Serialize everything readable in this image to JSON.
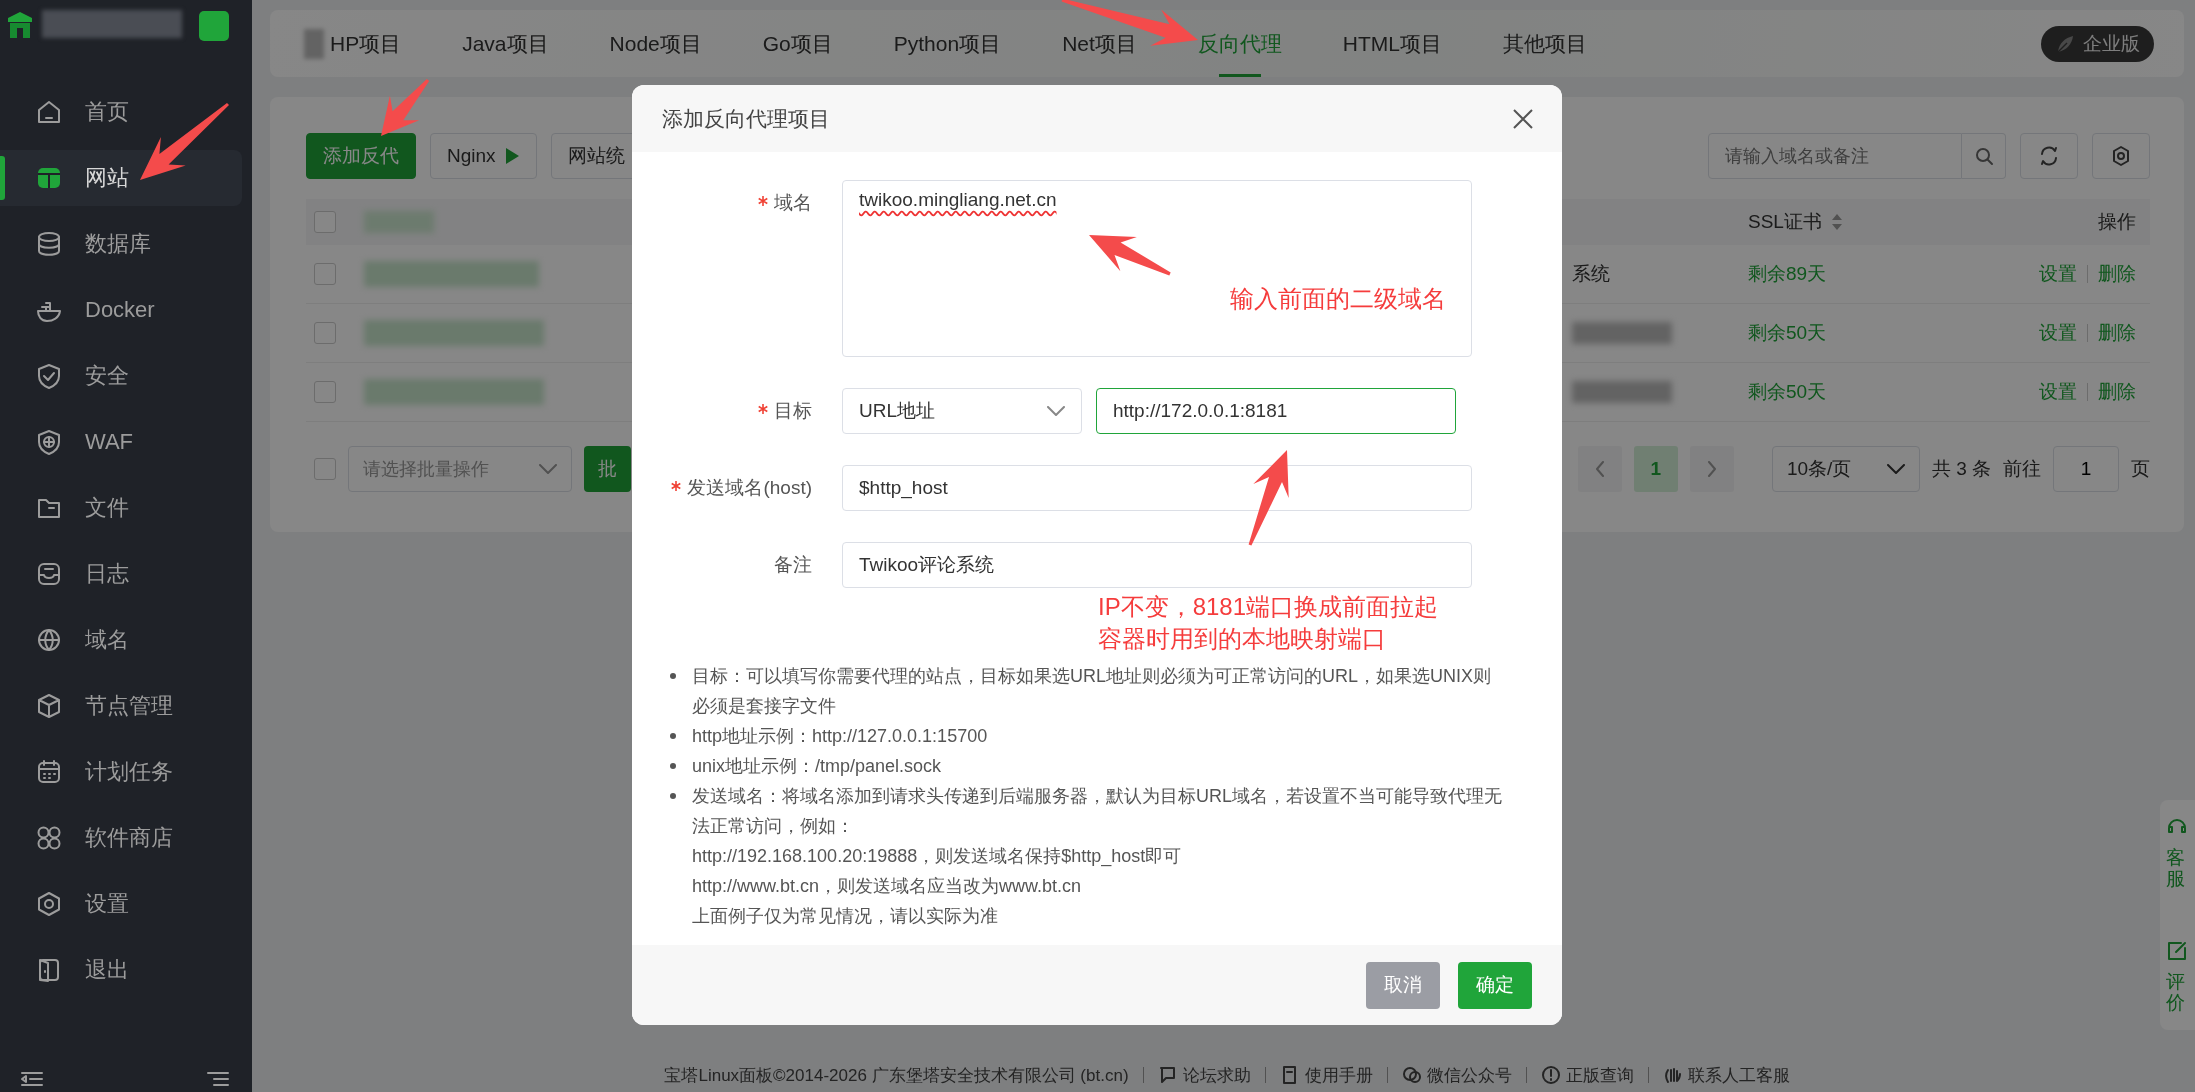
{
  "sidebar": {
    "items": [
      {
        "label": "首页",
        "selected": false
      },
      {
        "label": "网站",
        "selected": true
      },
      {
        "label": "数据库",
        "selected": false
      },
      {
        "label": "Docker",
        "selected": false
      },
      {
        "label": "安全",
        "selected": false
      },
      {
        "label": "WAF",
        "selected": false
      },
      {
        "label": "文件",
        "selected": false
      },
      {
        "label": "日志",
        "selected": false
      },
      {
        "label": "域名",
        "selected": false
      },
      {
        "label": "节点管理",
        "selected": false
      },
      {
        "label": "计划任务",
        "selected": false
      },
      {
        "label": "软件商店",
        "selected": false
      },
      {
        "label": "设置",
        "selected": false
      },
      {
        "label": "退出",
        "selected": false
      }
    ]
  },
  "tabs": [
    {
      "label": "HP项目",
      "selected": false
    },
    {
      "label": "Java项目",
      "selected": false
    },
    {
      "label": "Node项目",
      "selected": false
    },
    {
      "label": "Go项目",
      "selected": false
    },
    {
      "label": "Python项目",
      "selected": false
    },
    {
      "label": "Net项目",
      "selected": false
    },
    {
      "label": "反向代理",
      "selected": true
    },
    {
      "label": "HTML项目",
      "selected": false
    },
    {
      "label": "其他项目",
      "selected": false
    }
  ],
  "edition_badge": "企业版",
  "toolbar": {
    "buttons": [
      {
        "label": "添加反代",
        "kind": "primary"
      },
      {
        "label": "Nginx",
        "kind": "play"
      },
      {
        "label": "网站统",
        "kind": "default"
      }
    ],
    "search": {
      "placeholder": "请输入域名或备注"
    }
  },
  "table": {
    "columns": [
      {
        "label": "SSL证书",
        "sortable": true
      },
      {
        "label": "操作",
        "sortable": false
      }
    ],
    "header_checked": false,
    "rows": [
      {
        "checked": false,
        "note": "系统",
        "ssl": "剩余89天",
        "actions": [
          "设置",
          "删除"
        ]
      },
      {
        "checked": false,
        "ssl": "剩余50天",
        "actions": [
          "设置",
          "删除"
        ]
      },
      {
        "checked": false,
        "ssl": "剩余50天",
        "actions": [
          "设置",
          "删除"
        ]
      }
    ]
  },
  "batch": {
    "checked": false,
    "placeholder": "请选择批量操作",
    "button": "批"
  },
  "pagination": {
    "pages": [
      {
        "label": "1",
        "selected": true
      }
    ],
    "page_size": "10条/页",
    "total": "共 3 条",
    "goto": "前往",
    "goto_value": "1",
    "suffix": "页"
  },
  "footer": [
    "宝塔Linux面板©2014-2026 广东堡塔安全技术有限公司 (bt.cn)",
    "论坛求助",
    "使用手册",
    "微信公众号",
    "正版查询",
    "联系人工客服"
  ],
  "float_panel": [
    "客服",
    "评价"
  ],
  "modal": {
    "title": "添加反向代理项目",
    "fields": [
      {
        "label": "域名",
        "required": true,
        "kind": "textarea",
        "value": "twikoo.mingliang.net.cn",
        "focused": false
      },
      {
        "label": "目标",
        "required": true,
        "kind": "select_input",
        "select": "URL地址",
        "value": "http://172.0.0.1:8181",
        "focused": true
      },
      {
        "label": "发送域名(host)",
        "required": true,
        "kind": "input",
        "value": "$http_host",
        "focused": false
      },
      {
        "label": "备注",
        "required": false,
        "kind": "input",
        "value": "Twikoo评论系统",
        "focused": false
      }
    ],
    "notes": [
      {
        "text": "目标：可以填写你需要代理的站点，目标如果选URL地址则必须为可正常访问的URL，如果选UNIX则必须是套接字文件"
      },
      {
        "text": "http地址示例：http://127.0.0.1:15700"
      },
      {
        "text": "unix地址示例：/tmp/panel.sock"
      },
      {
        "text": "发送域名：将域名添加到请求头传递到后端服务器，默认为目标URL域名，若设置不当可能导致代理无法正常访问，例如：",
        "extra_lines": [
          "http://192.168.100.20:19888，则发送域名保持$http_host即可",
          "http://www.bt.cn，则发送域名应当改为www.bt.cn",
          "上面例子仅为常见情况，请以实际为准"
        ]
      }
    ],
    "buttons": [
      {
        "label": "取消",
        "kind": "secondary"
      },
      {
        "label": "确定",
        "kind": "primary"
      }
    ]
  },
  "annotations": [
    {
      "lines": [
        "输入前面的二级域名"
      ]
    },
    {
      "lines": [
        "IP不变，8181端口换成前面拉起",
        "容器时用到的本地映射端口"
      ]
    }
  ]
}
